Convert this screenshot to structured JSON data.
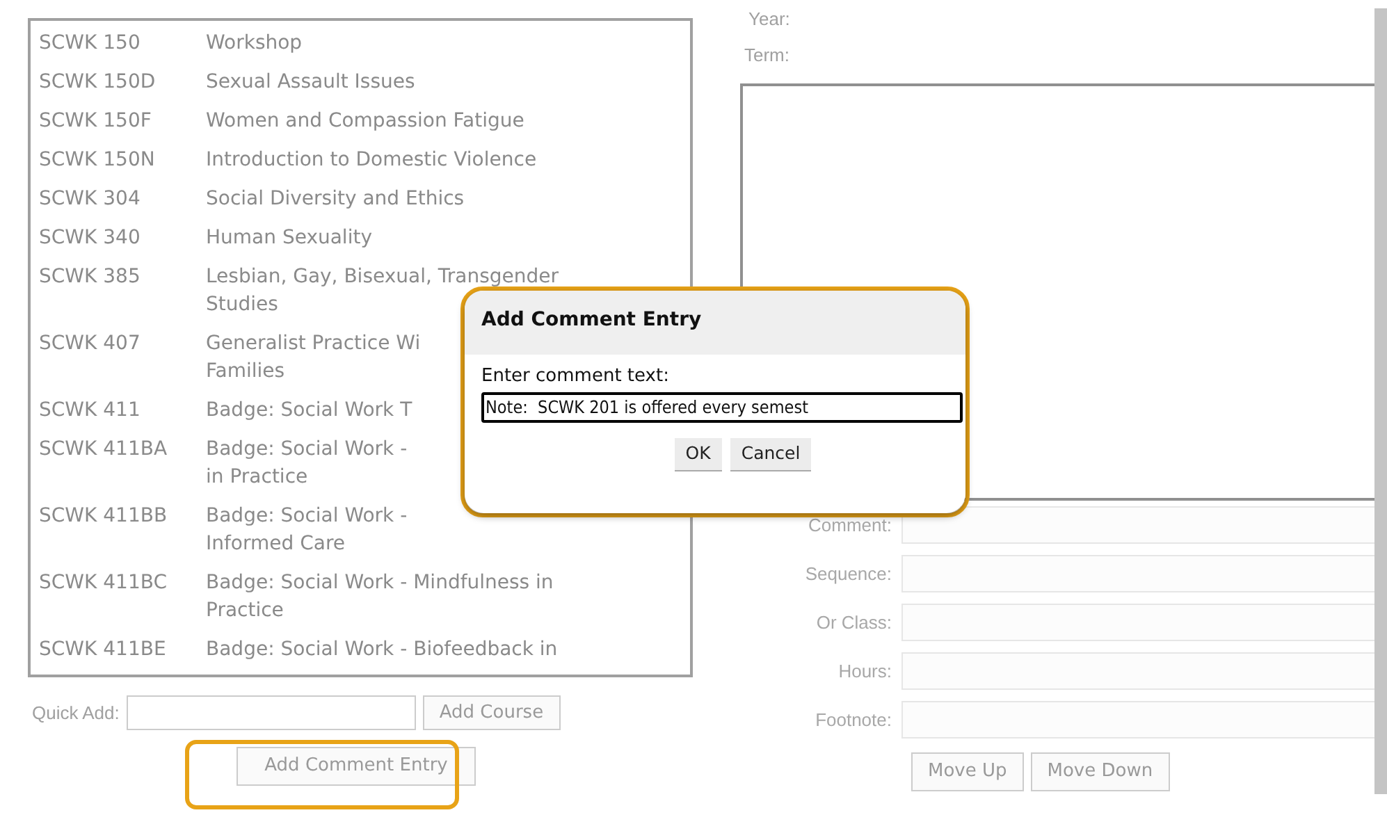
{
  "course_list": [
    {
      "code": "SCWK 150",
      "title_lines": [
        "Workshop"
      ]
    },
    {
      "code": "SCWK 150D",
      "title_lines": [
        "Sexual Assault Issues"
      ]
    },
    {
      "code": "SCWK 150F",
      "title_lines": [
        "Women and Compassion Fatigue"
      ]
    },
    {
      "code": "SCWK 150N",
      "title_lines": [
        "Introduction to Domestic Violence"
      ]
    },
    {
      "code": "SCWK 304",
      "title_lines": [
        "Social Diversity and Ethics"
      ]
    },
    {
      "code": "SCWK 340",
      "title_lines": [
        "Human Sexuality"
      ]
    },
    {
      "code": "SCWK 385",
      "title_lines": [
        "Lesbian, Gay, Bisexual, Transgender",
        "Studies"
      ]
    },
    {
      "code": "SCWK 407",
      "title_lines": [
        "Generalist Practice Wi",
        "Families"
      ]
    },
    {
      "code": "SCWK 411",
      "title_lines": [
        "Badge: Social Work T"
      ]
    },
    {
      "code": "SCWK 411BA",
      "title_lines": [
        "Badge: Social Work -",
        "in Practice"
      ]
    },
    {
      "code": "SCWK 411BB",
      "title_lines": [
        "Badge: Social Work -",
        "Informed Care"
      ]
    },
    {
      "code": "SCWK 411BC",
      "title_lines": [
        "Badge: Social Work - Mindfulness in",
        "Practice"
      ]
    },
    {
      "code": "SCWK 411BE",
      "title_lines": [
        "Badge: Social Work - Biofeedback in"
      ]
    }
  ],
  "quick_add": {
    "label": "Quick Add:",
    "button": "Add Course"
  },
  "add_comment_button": {
    "label": "Add Comment Entry",
    "highlighted": true
  },
  "right_panel": {
    "year_label": "Year:",
    "term_label": "Term:",
    "fields": [
      {
        "label": "Comment:"
      },
      {
        "label": "Sequence:"
      },
      {
        "label": "Or Class:"
      },
      {
        "label": "Hours:"
      },
      {
        "label": "Footnote:"
      }
    ],
    "buttons": [
      "Move Up",
      "Move Down"
    ]
  },
  "dialog": {
    "title": "Add Comment Entry",
    "prompt": "Enter comment text:",
    "value": "Note:  SCWK 201 is offered every semest",
    "buttons": [
      "OK",
      "Cancel"
    ],
    "highlighted": true
  }
}
